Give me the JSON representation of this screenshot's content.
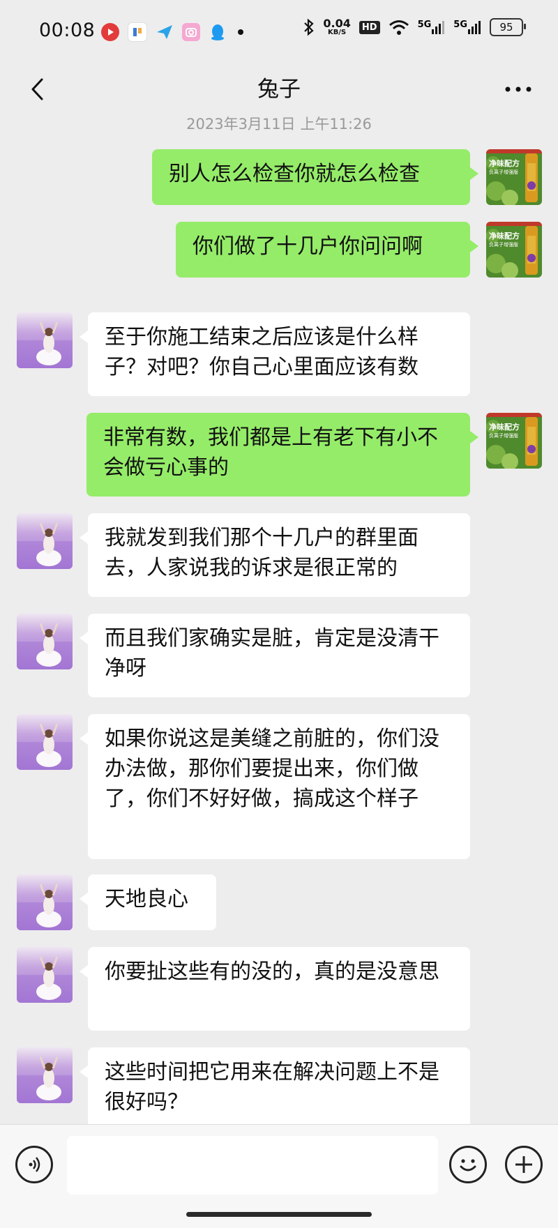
{
  "status_bar": {
    "time": "00:08",
    "net_speed_value": "0.04",
    "net_speed_unit": "KB/S",
    "hd_label": "HD",
    "signal_1": "5G",
    "signal_2": "5G",
    "battery": "95",
    "notification_icons": [
      "video-app-icon",
      "tasks-app-icon",
      "messenger-app-icon",
      "camera-app-icon",
      "qq-penguin-icon"
    ]
  },
  "nav": {
    "title": "兔子"
  },
  "chat": {
    "timestamp": "2023年3月11日 上午11:26",
    "messages": [
      {
        "side": "self",
        "text": "别人怎么检查你就怎么检查"
      },
      {
        "side": "self",
        "text": "你们做了十几户你问问啊"
      },
      {
        "side": "other",
        "text": "至于你施工结束之后应该是什么样子？对吧？你自己心里面应该有数"
      },
      {
        "side": "self",
        "text": "非常有数，我们都是上有老下有小不会做亏心事的"
      },
      {
        "side": "other",
        "text": "我就发到我们那个十几户的群里面去，人家说我的诉求是很正常的"
      },
      {
        "side": "other",
        "text": "而且我们家确实是脏，肯定是没清干净呀"
      },
      {
        "side": "other",
        "text": "如果你说这是美缝之前脏的，你们没办法做，那你们要提出来，你们做了，你们不好好做，搞成这个样子"
      },
      {
        "side": "other",
        "text": "天地良心"
      },
      {
        "side": "other",
        "text": "你要扯这些有的没的，真的是没意思"
      },
      {
        "side": "other",
        "text": "这些时间把它用来在解决问题上不是很好吗？"
      }
    ]
  },
  "self_avatar_text": {
    "line1": "净味配方",
    "line2": "负离子增强版"
  },
  "input_bar": {
    "placeholder": ""
  },
  "colors": {
    "self_bubble": "#95ec69",
    "other_bubble": "#ffffff",
    "background": "#ededed"
  }
}
